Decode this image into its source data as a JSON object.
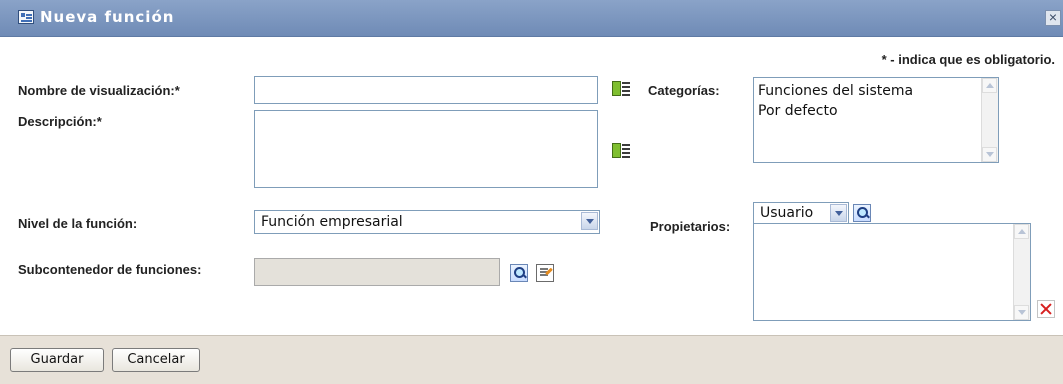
{
  "dialog": {
    "title": "Nueva función",
    "close_label": "×",
    "required_note": "* - indica que es obligatorio."
  },
  "fields": {
    "display_name_label": "Nombre de visualización:*",
    "display_name_value": "",
    "description_label": "Descripción:*",
    "description_value": "",
    "role_level_label": "Nivel de la función:",
    "role_level_value": "Función empresarial",
    "subcontainer_label": "Subcontenedor de funciones:",
    "subcontainer_value": "",
    "categories_label": "Categorías:",
    "categories": [
      "Funciones del sistema",
      "Por defecto"
    ],
    "owners_label": "Propietarios:",
    "owners_type": "Usuario",
    "owners_list": []
  },
  "footer": {
    "save_label": "Guardar",
    "cancel_label": "Cancelar"
  },
  "icons": {
    "title_icon": "role-icon",
    "language_icon": "localize-icon",
    "search_icon": "search-icon",
    "edit_icon": "edit-icon",
    "delete_icon": "delete-icon",
    "close_icon": "close-icon",
    "dropdown_icon": "chevron-down-icon"
  },
  "colors": {
    "title_bar": "#6f8bb6",
    "footer": "#e7e1d8",
    "input_border": "#7f9db9",
    "delete": "#d72020"
  }
}
